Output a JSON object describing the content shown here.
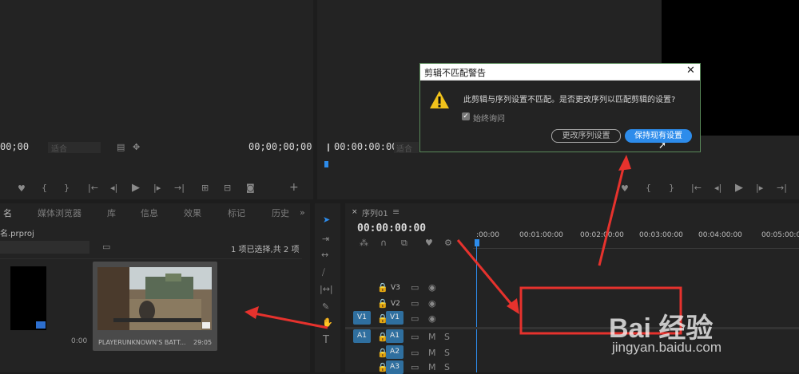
{
  "source_monitor": {
    "timecode_left": "00;00",
    "zoom_select": "适合",
    "timecode_right": "00;00;00;00"
  },
  "program_monitor": {
    "timecode": "00:00:00:00",
    "fit_select": "适合"
  },
  "dialog": {
    "title": "剪辑不匹配警告",
    "message": "此剪辑与序列设置不匹配。是否更改序列以匹配剪辑的设置?",
    "checkbox_label": "始终询问",
    "change_button": "更改序列设置",
    "keep_button": "保持现有设置"
  },
  "project_panel": {
    "tabs": [
      "名",
      "媒体浏览器",
      "库",
      "信息",
      "效果",
      "标记",
      "历史"
    ],
    "project_name": "名.prproj",
    "selection_info": "1 项已选择,共 2 项",
    "clips": [
      {
        "name": "",
        "duration": "0:00"
      },
      {
        "name": "PLAYERUNKNOWN'S BATT...",
        "duration": "29:05"
      }
    ]
  },
  "timeline": {
    "tab_label": "序列01",
    "timecode": "00:00:00:00",
    "ruler_labels": [
      ":00:00",
      "00:01:00:00",
      "00:02:00:00",
      "00:03:00:00",
      "00:04:00:00",
      "00:05:00:00"
    ],
    "video_tracks": [
      "V3",
      "V2",
      "V1"
    ],
    "audio_tracks": [
      "A1",
      "A2",
      "A3"
    ],
    "source_patch_video": "V1",
    "source_patch_audio": "A1"
  },
  "watermark": {
    "brand": "Bai 经验",
    "url": "jingyan.baidu.com"
  },
  "colors": {
    "accent": "#2d8ceb",
    "annotation": "#e6322d",
    "background": "#1d1d1d"
  }
}
